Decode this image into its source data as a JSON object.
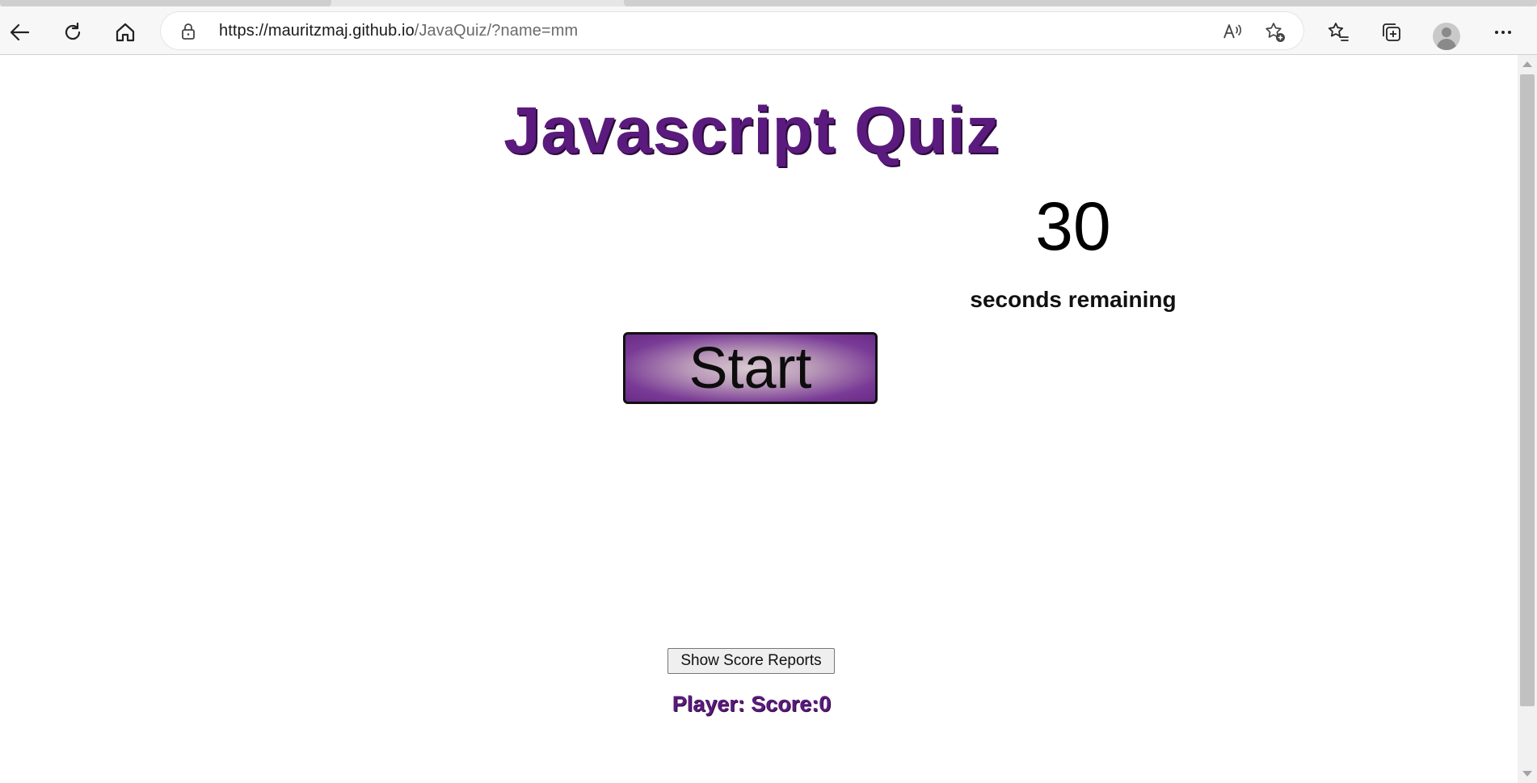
{
  "browser": {
    "url_host": "https://mauritzmaj.github.io",
    "url_path": "/JavaQuiz/?name=mm",
    "icons": {
      "back": "back-arrow-icon",
      "refresh": "refresh-icon",
      "home": "home-icon",
      "lock": "lock-icon",
      "read_aloud": "read-aloud-icon",
      "add_favorite": "add-favorite-icon",
      "favorites": "favorites-icon",
      "collections": "collections-icon",
      "profile": "profile-icon",
      "more": "more-icon"
    }
  },
  "page": {
    "title": "Javascript Quiz",
    "timer": {
      "value": "30",
      "label": "seconds remaining"
    },
    "start_button_label": "Start",
    "score_reports_button_label": "Show Score Reports",
    "player_score_text": "Player: Score:0",
    "colors": {
      "title": "#5b1a7d",
      "button_gradient_center": "#d9c9d2",
      "button_gradient_edge": "#6a2b88"
    }
  }
}
